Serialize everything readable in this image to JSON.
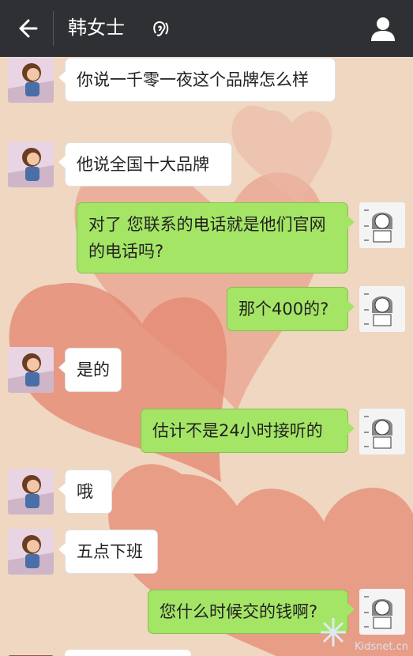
{
  "header": {
    "back_icon": "arrow-left-icon",
    "title": "韩女士",
    "voice_icon": "ear-icon",
    "profile_icon": "person-icon"
  },
  "colors": {
    "topbar": "#2e3034",
    "bubble_sent": "#a5e566",
    "bubble_received": "#ffffff",
    "background_heart": "#e58a73"
  },
  "messages": [
    {
      "side": "left",
      "text": "你说一千零一夜这个品牌怎么样"
    },
    {
      "side": "left",
      "text": "他说全国十大品牌"
    },
    {
      "side": "right",
      "text": "对了 您联系的电话就是他们官网的电话吗?"
    },
    {
      "side": "right",
      "text": "那个400的?"
    },
    {
      "side": "left",
      "text": "是的"
    },
    {
      "side": "right",
      "text": "估计不是24小时接听的"
    },
    {
      "side": "left",
      "text": "哦"
    },
    {
      "side": "left",
      "text": "五点下班"
    },
    {
      "side": "right",
      "text": "您什么时候交的钱啊?"
    }
  ],
  "watermark": "Kidsnet.cn"
}
